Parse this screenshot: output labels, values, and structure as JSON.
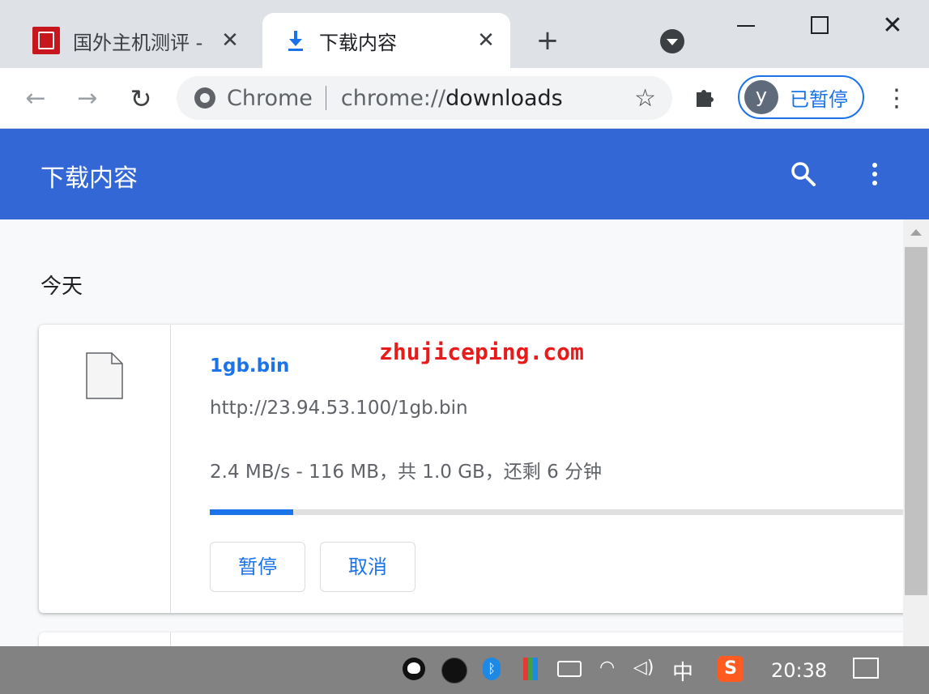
{
  "tabs": [
    {
      "title": "国外主机测评 - 国",
      "close": "✕",
      "favicon": "site-seal-icon"
    },
    {
      "title": "下载内容",
      "close": "✕",
      "favicon": "download-icon"
    }
  ],
  "tabstrip": {
    "new_tab": "+",
    "close_window": "✕"
  },
  "toolbar": {
    "back": "←",
    "forward": "→",
    "reload": "↻",
    "chip": "Chrome",
    "url_scheme": "chrome://",
    "url_host": "downloads",
    "star": "☆",
    "extensions": "✦",
    "profile_initial": "y",
    "profile_label": "已暂停",
    "menu": "⋮"
  },
  "page": {
    "title": "下载内容",
    "section_today": "今天"
  },
  "download": {
    "file_name": "1gb.bin",
    "url": "http://23.94.53.100/1gb.bin",
    "status": "2.4 MB/s - 116 MB，共 1.0 GB，还剩 6 分钟",
    "progress_percent": 12,
    "pause_label": "暂停",
    "cancel_label": "取消"
  },
  "watermark": "zhujiceping.com",
  "taskbar": {
    "bluetooth": "ᛒ",
    "wifi": "◠",
    "volume": "◁)",
    "ime": "中",
    "sogou": "S",
    "time": "20:38"
  },
  "colors": {
    "appbar": "#3367d6",
    "link": "#1a73e8",
    "watermark": "#e81b1b"
  }
}
